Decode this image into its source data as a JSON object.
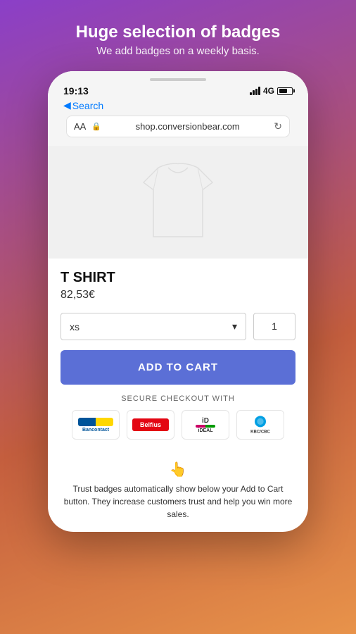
{
  "header": {
    "title": "Huge selection of badges",
    "subtitle": "We add badges on a weekly basis."
  },
  "phone": {
    "status_bar": {
      "time": "19:13",
      "network": "4G"
    },
    "nav": {
      "back_label": "Search"
    },
    "address_bar": {
      "aa_label": "AA",
      "url": "shop.conversionbear.com"
    }
  },
  "product": {
    "name": "T SHIRT",
    "price": "82,53€",
    "size_default": "xs",
    "quantity_default": "1",
    "add_to_cart_label": "ADD TO CART",
    "secure_checkout_label": "SECURE CHECKOUT WITH"
  },
  "payment_methods": [
    {
      "name": "Bancontact",
      "id": "bancontact"
    },
    {
      "name": "Belfius",
      "id": "belfius"
    },
    {
      "name": "iDEAL",
      "id": "ideal"
    },
    {
      "name": "KBC/CBC",
      "id": "kbc"
    }
  ],
  "trust": {
    "emoji": "👆",
    "text": "Trust badges automatically show below your Add to Cart button. They increase customers trust and help you win more sales."
  }
}
